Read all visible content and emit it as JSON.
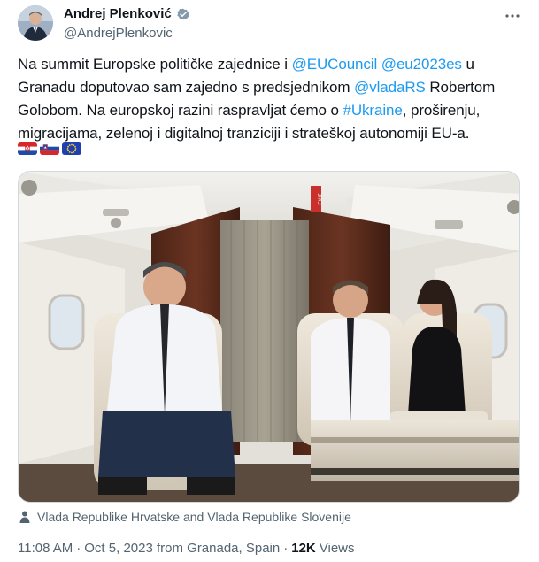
{
  "author": {
    "display_name": "Andrej Plenković",
    "handle": "@AndrejPlenkovic",
    "verified_icon": "verified-badge-icon",
    "avatar": "avatar"
  },
  "tweet": {
    "segments": [
      {
        "text": "Na summit Europske političke zajednice i ",
        "type": "text"
      },
      {
        "text": "@EUCouncil",
        "type": "link"
      },
      {
        "text": " ",
        "type": "text"
      },
      {
        "text": "@eu2023es",
        "type": "link"
      },
      {
        "text": " u Granadu doputovao sam zajedno s predsjednikom ",
        "type": "text"
      },
      {
        "text": "@vladaRS",
        "type": "link"
      },
      {
        "text": " Robertom Golobom. Na europskoj razini raspravljat ćemo o ",
        "type": "text"
      },
      {
        "text": "#Ukraine",
        "type": "link"
      },
      {
        "text": ", proširenju, migracijama, zelenoj i digitalnoj tranziciji i strateškoj autonomiji EU-a.",
        "type": "text"
      }
    ],
    "flags": [
      "croatia-flag",
      "slovenia-flag",
      "eu-flag"
    ]
  },
  "photo": {
    "caption": "Vlada Republike Hrvatske and Vlada Republike Slovenije",
    "exit_sign": "EXIT"
  },
  "meta": {
    "time": "11:08 AM",
    "separator": "·",
    "date": "Oct 5, 2023 from Granada, Spain",
    "views_count": "12K",
    "views_label": "Views"
  },
  "colors": {
    "link": "#1d9bf0",
    "text": "#0f1419",
    "secondary": "#536471"
  }
}
